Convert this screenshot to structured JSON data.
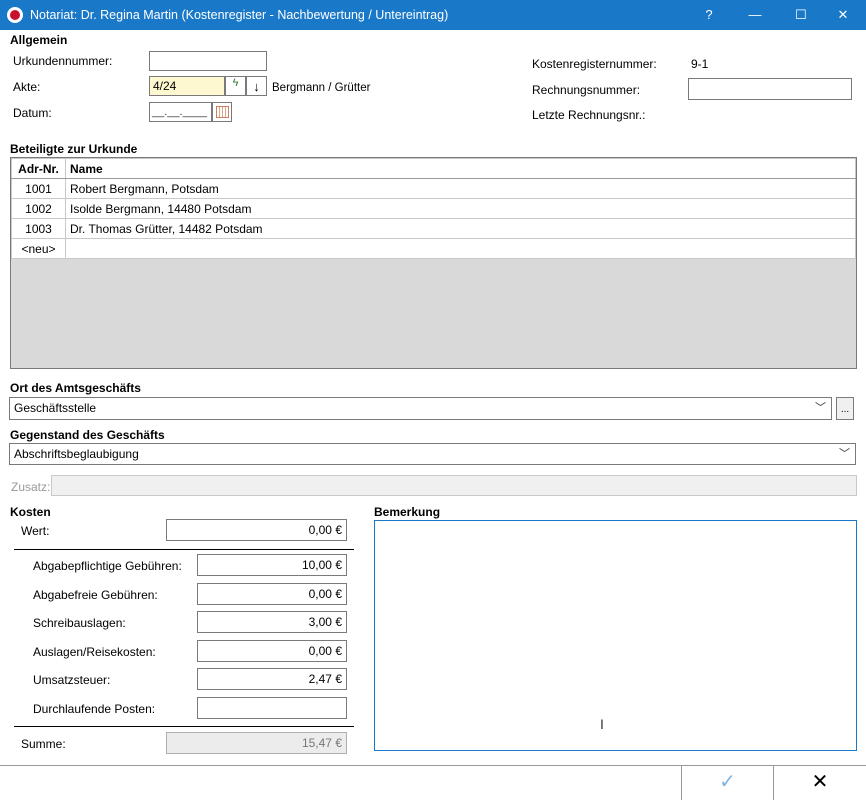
{
  "window": {
    "title": "Notariat: Dr. Regina Martin (Kostenregister - Nachbewertung / Untereintrag)",
    "help": "?",
    "minimize": "—",
    "maximize": "☐",
    "close": "✕"
  },
  "allgemein": {
    "heading": "Allgemein",
    "urkundennummer_label": "Urkundennummer:",
    "urkundennummer_value": "",
    "akte_label": "Akte:",
    "akte_value": "4/24",
    "akte_name": "Bergmann / Grütter",
    "datum_label": "Datum:",
    "datum_placeholder": "__.__.____",
    "kostenregisternummer_label": "Kostenregisternummer:",
    "kostenregisternummer_value": "9-1",
    "rechnungsnummer_label": "Rechnungsnummer:",
    "rechnungsnummer_value": "",
    "letzte_rechnungsnr_label": "Letzte Rechnungsnr.:"
  },
  "beteiligte": {
    "heading": "Beteiligte zur Urkunde",
    "columns": [
      "Adr-Nr.",
      "Name"
    ],
    "rows": [
      {
        "nr": "1001",
        "name": "Robert Bergmann, Potsdam"
      },
      {
        "nr": "1002",
        "name": "Isolde Bergmann, 14480 Potsdam"
      },
      {
        "nr": "1003",
        "name": "Dr. Thomas Grütter, 14482 Potsdam"
      },
      {
        "nr": "<neu>",
        "name": ""
      }
    ]
  },
  "ort": {
    "heading": "Ort des Amtsgeschäfts",
    "value": "Geschäftsstelle",
    "browse": "..."
  },
  "gegenstand": {
    "heading": "Gegenstand des Geschäfts",
    "value": "Abschriftsbeglaubigung",
    "zusatz_label": "Zusatz:",
    "zusatz_value": ""
  },
  "kosten": {
    "heading": "Kosten",
    "wert_label": "Wert:",
    "wert_value": "0,00 €",
    "items": [
      {
        "label": "Abgabepflichtige Gebühren:",
        "value": "10,00 €"
      },
      {
        "label": "Abgabefreie Gebühren:",
        "value": "0,00 €"
      },
      {
        "label": "Schreibauslagen:",
        "value": "3,00 €"
      },
      {
        "label": "Auslagen/Reisekosten:",
        "value": "0,00 €"
      },
      {
        "label": "Umsatzsteuer:",
        "value": "2,47 €"
      },
      {
        "label": "Durchlaufende Posten:",
        "value": ""
      }
    ],
    "summe_label": "Summe:",
    "summe_value": "15,47 €"
  },
  "bemerkung": {
    "heading": "Bemerkung",
    "value": ""
  },
  "footer": {
    "ok": "✓",
    "cancel": "✕"
  },
  "icons": {
    "accent": "#1a78c9",
    "ok_color": "#7fb5e0"
  }
}
